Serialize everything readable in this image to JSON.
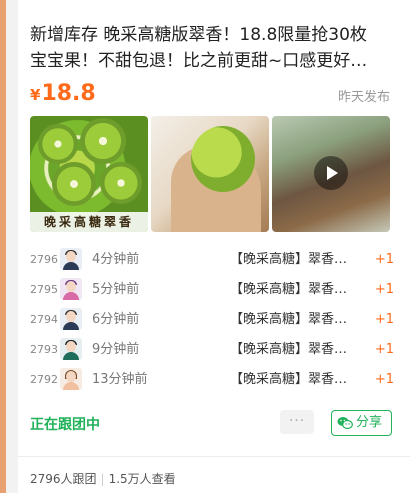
{
  "post": {
    "title": "新增库存 晚采高糖版翠香！18.8限量抢30枚宝宝果！不甜包退！比之前更甜~口感更好~ 💧传…",
    "price_symbol": "¥",
    "price_value": "18.8",
    "posted_time": "昨天发布",
    "image_caption": "晚采高糖翠香"
  },
  "orders": [
    {
      "num": "2796",
      "time": "4分钟前",
      "item": "【晚采高糖】翠香…",
      "qty": "+1"
    },
    {
      "num": "2795",
      "time": "5分钟前",
      "item": "【晚采高糖】翠香…",
      "qty": "+1"
    },
    {
      "num": "2794",
      "time": "6分钟前",
      "item": "【晚采高糖】翠香…",
      "qty": "+1"
    },
    {
      "num": "2793",
      "time": "9分钟前",
      "item": "【晚采高糖】翠香…",
      "qty": "+1"
    },
    {
      "num": "2792",
      "time": "13分钟前",
      "item": "【晚采高糖】翠香…",
      "qty": "+1"
    }
  ],
  "actions": {
    "status": "正在跟团中",
    "more": "···",
    "share": "分享"
  },
  "footer": {
    "joined": "2796人跟团",
    "views": "1.5万人查看"
  },
  "colors": {
    "price": "#ff6a1a",
    "accent_green": "#21b25a"
  }
}
